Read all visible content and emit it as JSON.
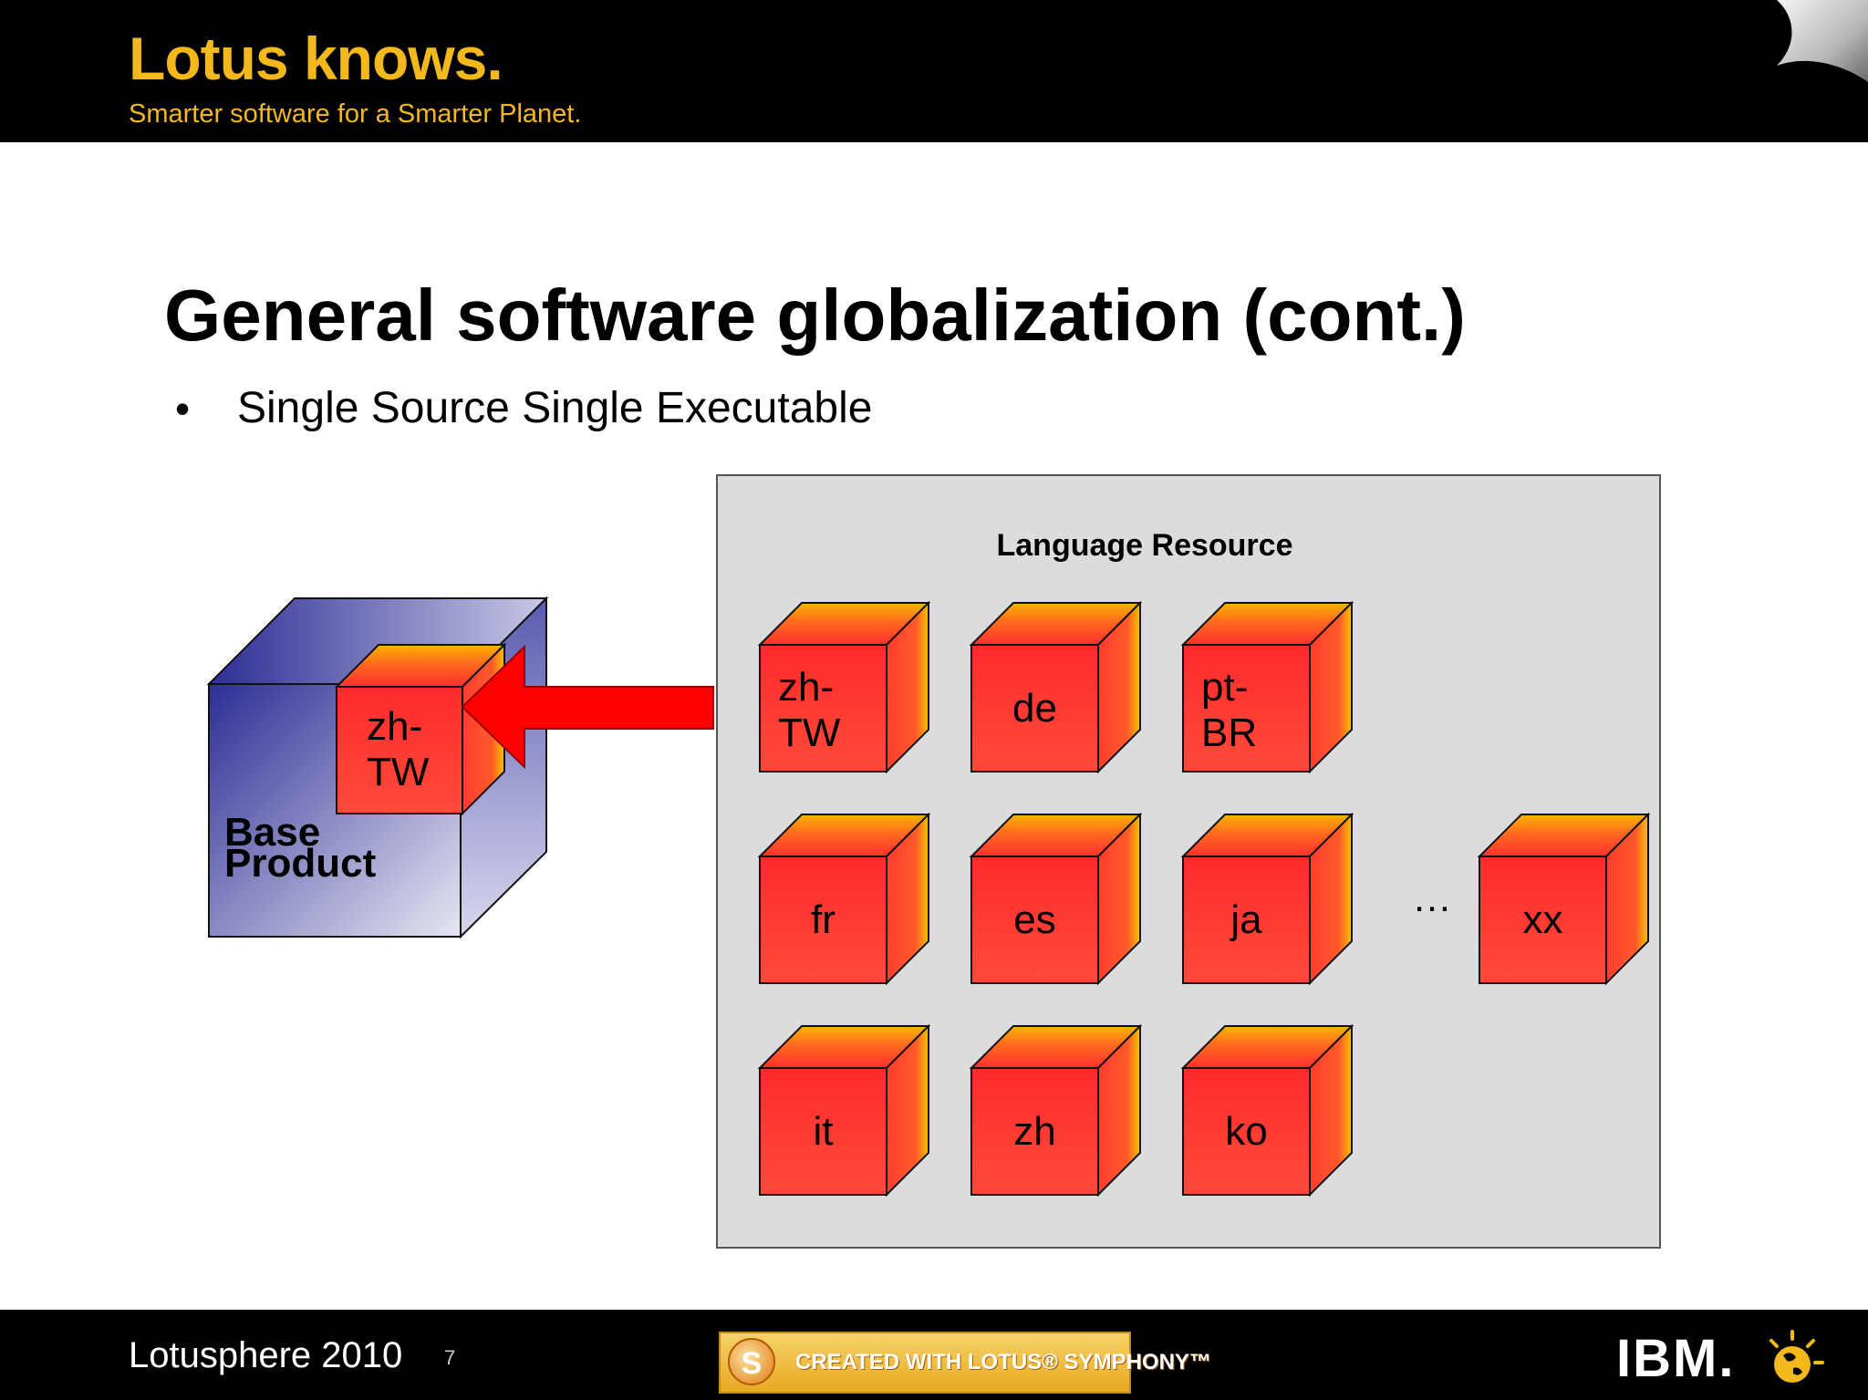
{
  "header": {
    "brand_title": "Lotus knows.",
    "brand_tagline": "Smarter software for a Smarter Planet."
  },
  "slide": {
    "title": "General software globalization (cont.)",
    "bullets": [
      "Single Source Single Executable"
    ]
  },
  "diagram": {
    "resource_group_label": "Language Resource",
    "base_product": {
      "label": "Base Product",
      "embedded_cube": "zh-\nTW"
    },
    "resource_cubes": [
      {
        "label": "zh-\nTW"
      },
      {
        "label": "de"
      },
      {
        "label": "pt-\nBR"
      },
      {
        "label": "fr"
      },
      {
        "label": "es"
      },
      {
        "label": "ja"
      },
      {
        "label": "xx"
      },
      {
        "label": "it"
      },
      {
        "label": "zh"
      },
      {
        "label": "ko"
      }
    ],
    "ellipsis": "…",
    "colors": {
      "cube_red": "#ff3b30",
      "cube_highlight": "#f7c400",
      "base_blue": "#3a3a9c",
      "panel_gray": "#dcdcdc",
      "arrow_red": "#ff0000"
    }
  },
  "footer": {
    "event": "Lotusphere 2010",
    "page_number": "7",
    "badge_text": "CREATED WITH LOTUS® SYMPHONY™",
    "badge_logo_letter": "S",
    "company_logo": "IBM."
  }
}
